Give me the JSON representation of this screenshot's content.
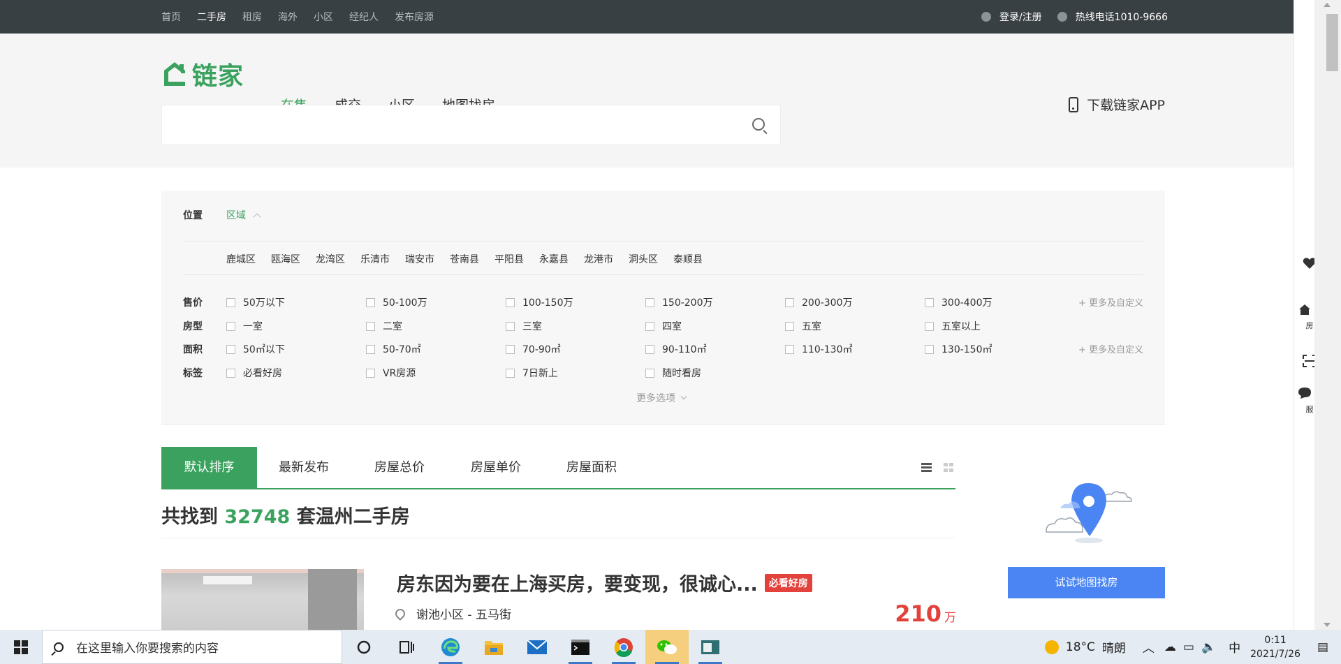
{
  "topbar": {
    "nav": [
      "首页",
      "二手房",
      "租房",
      "海外",
      "小区",
      "经纪人",
      "发布房源"
    ],
    "active_index": 1,
    "login": "登录/注册",
    "hotline": "热线电话1010-9666"
  },
  "header": {
    "logo_text": "链家",
    "nav": [
      "在售",
      "成交",
      "小区",
      "地图找房"
    ],
    "active_index": 0,
    "download": "下载链家APP"
  },
  "search": {
    "placeholder": ""
  },
  "filters": {
    "location_label": "位置",
    "region_tab": "区域",
    "districts": [
      "鹿城区",
      "瓯海区",
      "龙湾区",
      "乐清市",
      "瑞安市",
      "苍南县",
      "平阳县",
      "永嘉县",
      "龙港市",
      "洞头区",
      "泰顺县"
    ],
    "price": {
      "label": "售价",
      "options": [
        "50万以下",
        "50-100万",
        "100-150万",
        "150-200万",
        "200-300万",
        "300-400万"
      ],
      "more": "+ 更多及自定义"
    },
    "rooms": {
      "label": "房型",
      "options": [
        "一室",
        "二室",
        "三室",
        "四室",
        "五室",
        "五室以上"
      ]
    },
    "area": {
      "label": "面积",
      "options": [
        "50㎡以下",
        "50-70㎡",
        "70-90㎡",
        "90-110㎡",
        "110-130㎡",
        "130-150㎡"
      ],
      "more": "+ 更多及自定义"
    },
    "tags": {
      "label": "标签",
      "options": [
        "必看好房",
        "VR房源",
        "7日新上",
        "随时看房"
      ]
    },
    "more_options": "更多选项"
  },
  "sort_tabs": [
    "默认排序",
    "最新发布",
    "房屋总价",
    "房屋单价",
    "房屋面积"
  ],
  "result": {
    "prefix": "共找到",
    "count": "32748",
    "suffix": "套温州二手房"
  },
  "listing": {
    "title": "房东因为要在上海买房，要变现，很诚心...",
    "badge": "必看好房",
    "address": "谢池小区 - 五马街",
    "price": "210",
    "price_unit": "万"
  },
  "map_card": {
    "button": "试试地图找房"
  },
  "floatbar": {
    "sell": "卖房",
    "service": "客服"
  },
  "taskbar": {
    "search_placeholder": "在这里输入你要搜索的内容",
    "temperature": "18°C",
    "weather": "晴朗",
    "ime": "中",
    "time": "0:11",
    "date": "2021/7/26"
  },
  "colors": {
    "brand": "#3aa25e",
    "accent_red": "#e3413b",
    "map_button": "#4a85f3",
    "topbar_bg": "#394043"
  }
}
